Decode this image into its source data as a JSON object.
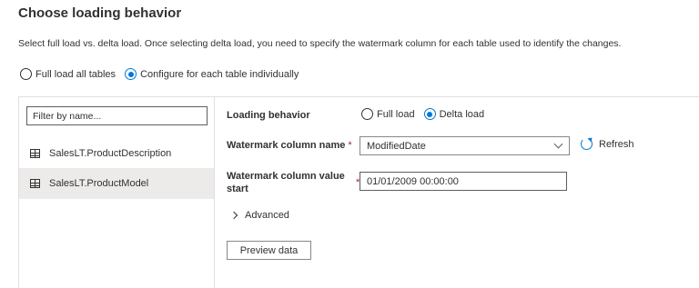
{
  "header": {
    "title": "Choose loading behavior",
    "description": "Select full load vs. delta load. Once selecting delta load, you need to specify the watermark column for each table used to identify the changes."
  },
  "mode": {
    "options": [
      {
        "label": "Full load all tables",
        "selected": false
      },
      {
        "label": "Configure for each table individually",
        "selected": true
      }
    ]
  },
  "sidebar": {
    "filter_placeholder": "Filter by name...",
    "tables": [
      {
        "label": "SalesLT.ProductDescription",
        "selected": false
      },
      {
        "label": "SalesLT.ProductModel",
        "selected": true
      }
    ]
  },
  "details": {
    "loading_behavior_label": "Loading behavior",
    "loading_options": [
      {
        "label": "Full load",
        "selected": false
      },
      {
        "label": "Delta load",
        "selected": true
      }
    ],
    "watermark_column_label": "Watermark column name",
    "required_mark": "*",
    "watermark_column_value": "ModifiedDate",
    "refresh_label": "Refresh",
    "watermark_start_label": "Watermark column value start",
    "watermark_start_value": "01/01/2009 00:00:00",
    "advanced_label": "Advanced",
    "preview_button": "Preview data"
  },
  "colors": {
    "accent": "#0078d4",
    "required": "#a4262c",
    "selected_row": "#edebe9",
    "border": "#e1dfdd"
  }
}
